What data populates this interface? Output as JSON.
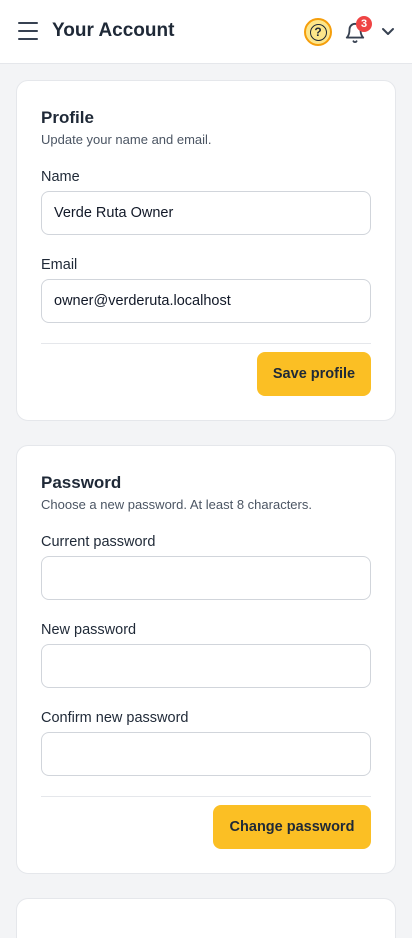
{
  "header": {
    "title": "Your Account",
    "notification_count": "3",
    "help_glyph": "?"
  },
  "profile": {
    "title": "Profile",
    "description": "Update your name and email.",
    "name_label": "Name",
    "name_value": "Verde Ruta Owner",
    "email_label": "Email",
    "email_value": "owner@verderuta.localhost",
    "save_label": "Save profile"
  },
  "password": {
    "title": "Password",
    "description": "Choose a new password. At least 8 characters.",
    "current_label": "Current password",
    "current_value": "",
    "new_label": "New password",
    "new_value": "",
    "confirm_label": "Confirm new password",
    "confirm_value": "",
    "change_label": "Change password"
  },
  "colors": {
    "accent": "#fbbf24",
    "badge": "#ef4444"
  },
  "icons": {
    "menu": "hamburger-menu-icon",
    "help": "help-icon",
    "notifications": "bell-icon",
    "user_menu": "chevron-down-icon"
  }
}
